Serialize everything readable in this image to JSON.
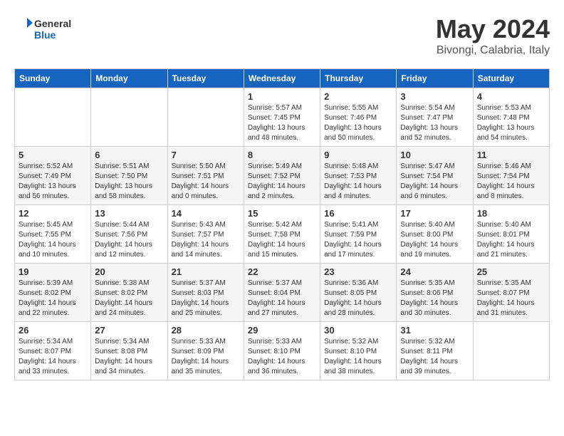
{
  "header": {
    "logo": {
      "general": "General",
      "blue": "Blue"
    },
    "title": "May 2024",
    "location": "Bivongi, Calabria, Italy"
  },
  "calendar": {
    "weekdays": [
      "Sunday",
      "Monday",
      "Tuesday",
      "Wednesday",
      "Thursday",
      "Friday",
      "Saturday"
    ],
    "weeks": [
      [
        {
          "day": "",
          "sunrise": "",
          "sunset": "",
          "daylight": ""
        },
        {
          "day": "",
          "sunrise": "",
          "sunset": "",
          "daylight": ""
        },
        {
          "day": "",
          "sunrise": "",
          "sunset": "",
          "daylight": ""
        },
        {
          "day": "1",
          "sunrise": "5:57 AM",
          "sunset": "7:45 PM",
          "daylight": "13 hours and 48 minutes."
        },
        {
          "day": "2",
          "sunrise": "5:55 AM",
          "sunset": "7:46 PM",
          "daylight": "13 hours and 50 minutes."
        },
        {
          "day": "3",
          "sunrise": "5:54 AM",
          "sunset": "7:47 PM",
          "daylight": "13 hours and 52 minutes."
        },
        {
          "day": "4",
          "sunrise": "5:53 AM",
          "sunset": "7:48 PM",
          "daylight": "13 hours and 54 minutes."
        }
      ],
      [
        {
          "day": "5",
          "sunrise": "5:52 AM",
          "sunset": "7:49 PM",
          "daylight": "13 hours and 56 minutes."
        },
        {
          "day": "6",
          "sunrise": "5:51 AM",
          "sunset": "7:50 PM",
          "daylight": "13 hours and 58 minutes."
        },
        {
          "day": "7",
          "sunrise": "5:50 AM",
          "sunset": "7:51 PM",
          "daylight": "14 hours and 0 minutes."
        },
        {
          "day": "8",
          "sunrise": "5:49 AM",
          "sunset": "7:52 PM",
          "daylight": "14 hours and 2 minutes."
        },
        {
          "day": "9",
          "sunrise": "5:48 AM",
          "sunset": "7:53 PM",
          "daylight": "14 hours and 4 minutes."
        },
        {
          "day": "10",
          "sunrise": "5:47 AM",
          "sunset": "7:54 PM",
          "daylight": "14 hours and 6 minutes."
        },
        {
          "day": "11",
          "sunrise": "5:46 AM",
          "sunset": "7:54 PM",
          "daylight": "14 hours and 8 minutes."
        }
      ],
      [
        {
          "day": "12",
          "sunrise": "5:45 AM",
          "sunset": "7:55 PM",
          "daylight": "14 hours and 10 minutes."
        },
        {
          "day": "13",
          "sunrise": "5:44 AM",
          "sunset": "7:56 PM",
          "daylight": "14 hours and 12 minutes."
        },
        {
          "day": "14",
          "sunrise": "5:43 AM",
          "sunset": "7:57 PM",
          "daylight": "14 hours and 14 minutes."
        },
        {
          "day": "15",
          "sunrise": "5:42 AM",
          "sunset": "7:58 PM",
          "daylight": "14 hours and 15 minutes."
        },
        {
          "day": "16",
          "sunrise": "5:41 AM",
          "sunset": "7:59 PM",
          "daylight": "14 hours and 17 minutes."
        },
        {
          "day": "17",
          "sunrise": "5:40 AM",
          "sunset": "8:00 PM",
          "daylight": "14 hours and 19 minutes."
        },
        {
          "day": "18",
          "sunrise": "5:40 AM",
          "sunset": "8:01 PM",
          "daylight": "14 hours and 21 minutes."
        }
      ],
      [
        {
          "day": "19",
          "sunrise": "5:39 AM",
          "sunset": "8:02 PM",
          "daylight": "14 hours and 22 minutes."
        },
        {
          "day": "20",
          "sunrise": "5:38 AM",
          "sunset": "8:02 PM",
          "daylight": "14 hours and 24 minutes."
        },
        {
          "day": "21",
          "sunrise": "5:37 AM",
          "sunset": "8:03 PM",
          "daylight": "14 hours and 25 minutes."
        },
        {
          "day": "22",
          "sunrise": "5:37 AM",
          "sunset": "8:04 PM",
          "daylight": "14 hours and 27 minutes."
        },
        {
          "day": "23",
          "sunrise": "5:36 AM",
          "sunset": "8:05 PM",
          "daylight": "14 hours and 28 minutes."
        },
        {
          "day": "24",
          "sunrise": "5:35 AM",
          "sunset": "8:06 PM",
          "daylight": "14 hours and 30 minutes."
        },
        {
          "day": "25",
          "sunrise": "5:35 AM",
          "sunset": "8:07 PM",
          "daylight": "14 hours and 31 minutes."
        }
      ],
      [
        {
          "day": "26",
          "sunrise": "5:34 AM",
          "sunset": "8:07 PM",
          "daylight": "14 hours and 33 minutes."
        },
        {
          "day": "27",
          "sunrise": "5:34 AM",
          "sunset": "8:08 PM",
          "daylight": "14 hours and 34 minutes."
        },
        {
          "day": "28",
          "sunrise": "5:33 AM",
          "sunset": "8:09 PM",
          "daylight": "14 hours and 35 minutes."
        },
        {
          "day": "29",
          "sunrise": "5:33 AM",
          "sunset": "8:10 PM",
          "daylight": "14 hours and 36 minutes."
        },
        {
          "day": "30",
          "sunrise": "5:32 AM",
          "sunset": "8:10 PM",
          "daylight": "14 hours and 38 minutes."
        },
        {
          "day": "31",
          "sunrise": "5:32 AM",
          "sunset": "8:11 PM",
          "daylight": "14 hours and 39 minutes."
        },
        {
          "day": "",
          "sunrise": "",
          "sunset": "",
          "daylight": ""
        }
      ]
    ]
  }
}
